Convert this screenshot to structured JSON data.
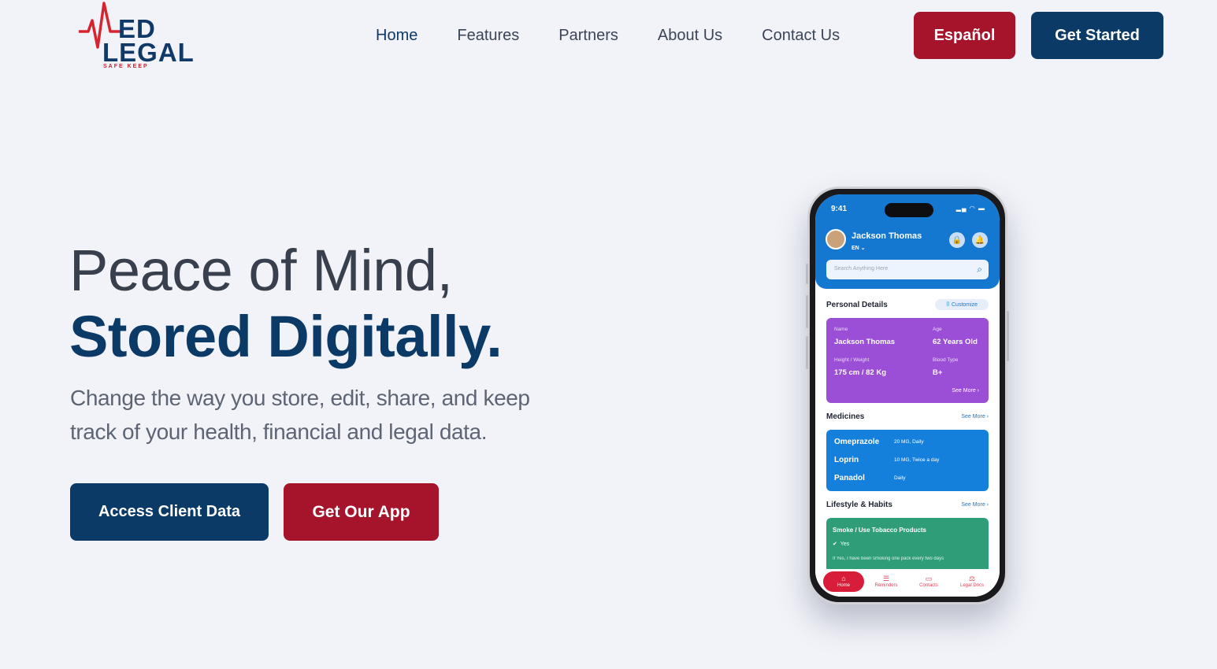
{
  "brand": {
    "logo_text_top": "ED",
    "logo_text_bottom": "LEGAL",
    "logo_tagline": "SAFE KEEP"
  },
  "nav": {
    "items": [
      {
        "label": "Home",
        "active": true
      },
      {
        "label": "Features"
      },
      {
        "label": "Partners"
      },
      {
        "label": "About Us"
      },
      {
        "label": "Contact Us"
      }
    ],
    "language_button": "Español",
    "cta_button": "Get Started"
  },
  "hero": {
    "title_line1": "Peace of Mind,",
    "title_line2": "Stored Digitally.",
    "subtitle": "Change the way you store, edit, share, and keep track of your health, financial and legal data.",
    "primary_button": "Access Client Data",
    "secondary_button": "Get Our App"
  },
  "phone": {
    "time": "9:41",
    "user_name": "Jackson Thomas",
    "language": "EN",
    "search_placeholder": "Search Anything Here",
    "personal_details": {
      "heading": "Personal Details",
      "customize": "Customize",
      "name_label": "Name",
      "name_value": "Jackson Thomas",
      "age_label": "Age",
      "age_value": "62 Years Old",
      "hw_label": "Height / Weight",
      "hw_value": "175 cm / 82 Kg",
      "blood_label": "Blood Type",
      "blood_value": "B+",
      "see_more": "See More"
    },
    "medicines": {
      "heading": "Medicines",
      "see_more": "See More",
      "items": [
        {
          "name": "Omeprazole",
          "dose": "20 MG, Daily"
        },
        {
          "name": "Loprin",
          "dose": "10 MG, Twice a day"
        },
        {
          "name": "Panadol",
          "dose": "Daily"
        }
      ]
    },
    "lifestyle": {
      "heading": "Lifestyle & Habits",
      "see_more": "See More",
      "question": "Smoke / Use Tobacco Products",
      "answer": "Yes",
      "note": "If Yes, I have been smoking one pack every two days"
    },
    "tabs": [
      "Home",
      "Reminders",
      "Contacts",
      "Legal Docs"
    ]
  },
  "colors": {
    "navy": "#0c3a66",
    "crimson": "#a6142b",
    "background": "#f2f3f9"
  }
}
